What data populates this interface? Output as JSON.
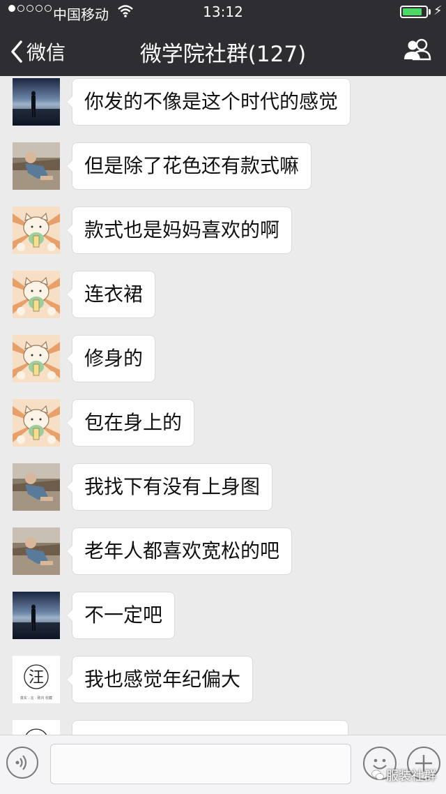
{
  "status_bar": {
    "carrier": "中国移动",
    "time": "13:12",
    "battery_level": 0.85,
    "signal_bars": 1
  },
  "nav": {
    "back_label": "微信",
    "title": "微学院社群(127)"
  },
  "messages": [
    {
      "avatar": "night-beach-avatar",
      "text": "你发的不像是这个时代的感觉"
    },
    {
      "avatar": "sofa-child-avatar",
      "text": "但是除了花色还有款式嘛"
    },
    {
      "avatar": "lucky-cat-avatar",
      "text": "款式也是妈妈喜欢的啊"
    },
    {
      "avatar": "lucky-cat-avatar",
      "text": "连衣裙"
    },
    {
      "avatar": "lucky-cat-avatar",
      "text": "修身的"
    },
    {
      "avatar": "lucky-cat-avatar",
      "text": "包在身上的"
    },
    {
      "avatar": "sofa-child-avatar",
      "text": "我找下有没有上身图"
    },
    {
      "avatar": "sofa-child-avatar",
      "text": "老年人都喜欢宽松的吧"
    },
    {
      "avatar": "night-beach-avatar",
      "text": "不一定吧"
    },
    {
      "avatar": "wang-logo-avatar",
      "text": "我也感觉年纪偏大"
    },
    {
      "avatar": "wang-logo-avatar",
      "text": ""
    }
  ],
  "avatar_text": {
    "wang_char": "汪",
    "wang_caption": "真实 · 言 · 致内 收藏"
  },
  "input": {
    "value": ""
  },
  "watermark": "服装社群",
  "colors": {
    "nav_bg": "#2e2e32",
    "chat_bg": "#ebebeb",
    "battery_green": "#4cd964",
    "bubble_bg": "#ffffff"
  }
}
